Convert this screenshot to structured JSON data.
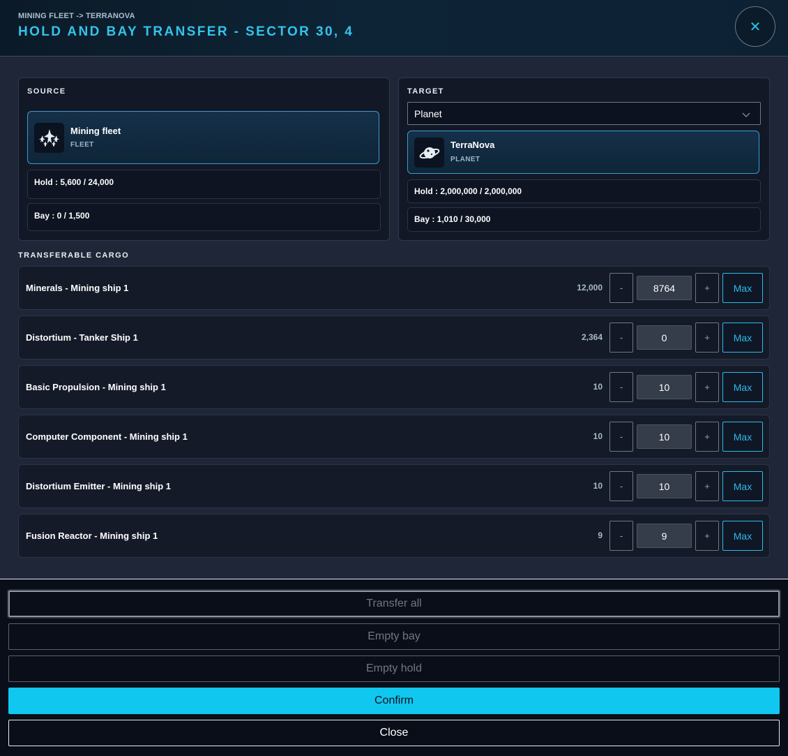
{
  "header": {
    "breadcrumb": "MINING FLEET -> TERRANOVA",
    "title": "HOLD AND BAY TRANSFER - SECTOR 30, 4",
    "close_glyph": "✕"
  },
  "source": {
    "title": "SOURCE",
    "entity": {
      "name": "Mining fleet",
      "type": "FLEET",
      "icon": "fleet-icon"
    },
    "hold": "Hold : 5,600 / 24,000",
    "bay": "Bay : 0 / 1,500"
  },
  "target": {
    "title": "TARGET",
    "select_value": "Planet",
    "entity": {
      "name": "TerraNova",
      "type": "PLANET",
      "icon": "planet-icon"
    },
    "hold": "Hold : 2,000,000 / 2,000,000",
    "bay": "Bay : 1,010 / 30,000"
  },
  "cargo": {
    "title": "TRANSFERABLE CARGO",
    "minus_label": "-",
    "plus_label": "+",
    "max_label": "Max",
    "items": [
      {
        "name": "Minerals - Mining ship 1",
        "available": "12,000",
        "quantity": "8764"
      },
      {
        "name": "Distortium - Tanker Ship 1",
        "available": "2,364",
        "quantity": "0"
      },
      {
        "name": "Basic Propulsion - Mining ship 1",
        "available": "10",
        "quantity": "10"
      },
      {
        "name": "Computer Component - Mining ship 1",
        "available": "10",
        "quantity": "10"
      },
      {
        "name": "Distortium Emitter - Mining ship 1",
        "available": "10",
        "quantity": "10"
      },
      {
        "name": "Fusion Reactor - Mining ship 1",
        "available": "9",
        "quantity": "9"
      }
    ]
  },
  "footer": {
    "transfer_all": "Transfer all",
    "empty_bay": "Empty bay",
    "empty_hold": "Empty hold",
    "confirm": "Confirm",
    "close": "Close"
  },
  "colors": {
    "accent": "#2dbbe8",
    "confirm": "#10c7ef",
    "title": "#34c3ea",
    "background": "#1f2637"
  }
}
